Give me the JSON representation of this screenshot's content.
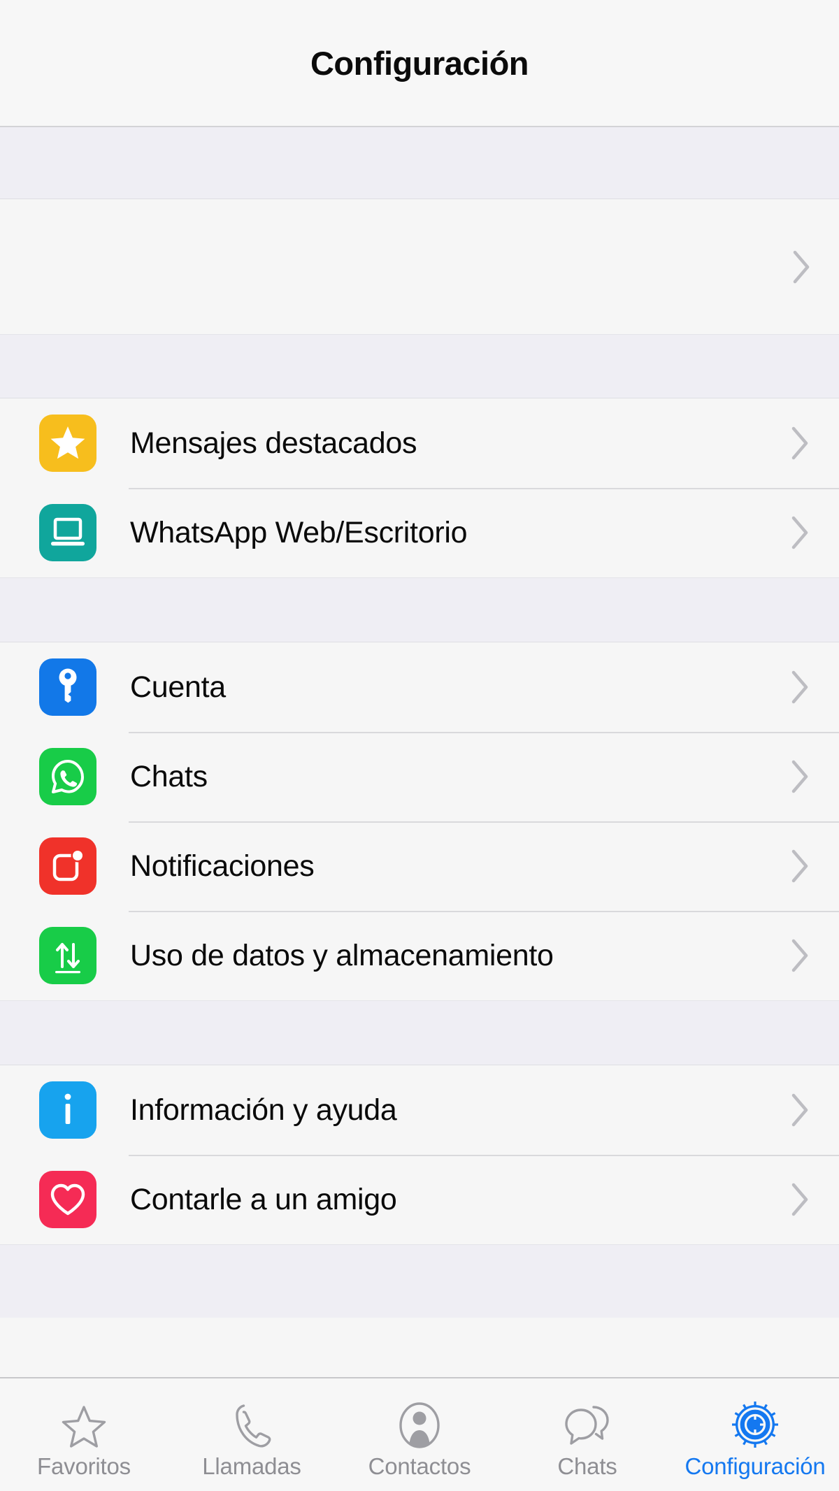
{
  "navbar": {
    "title": "Configuración"
  },
  "profile": {
    "name": "",
    "status": "",
    "chevron_icon": "chevron-right-icon"
  },
  "sections": [
    {
      "id": "starred-group",
      "items": [
        {
          "label": "Mensajes destacados",
          "icon": "star-icon",
          "color": "#F7BE1D",
          "chevron_icon": "chevron-right-icon"
        },
        {
          "label": "WhatsApp Web/Escritorio",
          "icon": "laptop-icon",
          "color": "#10A69C",
          "chevron_icon": "chevron-right-icon"
        }
      ]
    },
    {
      "id": "settings-group",
      "items": [
        {
          "label": "Cuenta",
          "icon": "key-icon",
          "color": "#1278E8",
          "chevron_icon": "chevron-right-icon"
        },
        {
          "label": "Chats",
          "icon": "whatsapp-icon",
          "color": "#18CC48",
          "chevron_icon": "chevron-right-icon"
        },
        {
          "label": "Notificaciones",
          "icon": "notification-badge-icon",
          "color": "#F0322A",
          "chevron_icon": "chevron-right-icon"
        },
        {
          "label": "Uso de datos y almacenamiento",
          "icon": "data-transfer-icon",
          "color": "#18CC48",
          "chevron_icon": "chevron-right-icon"
        }
      ]
    },
    {
      "id": "help-group",
      "items": [
        {
          "label": "Información y ayuda",
          "icon": "info-icon",
          "color": "#17A3EE",
          "chevron_icon": "chevron-right-icon"
        },
        {
          "label": "Contarle a un amigo",
          "icon": "heart-icon",
          "color": "#F52B55",
          "chevron_icon": "chevron-right-icon"
        }
      ]
    }
  ],
  "tabbar": {
    "active_color": "#1478F0",
    "inactive_color": "#8E8E93",
    "tabs": [
      {
        "label": "Favoritos",
        "icon": "star-outline-icon",
        "active": false
      },
      {
        "label": "Llamadas",
        "icon": "phone-icon",
        "active": false
      },
      {
        "label": "Contactos",
        "icon": "person-icon",
        "active": false
      },
      {
        "label": "Chats",
        "icon": "chat-bubbles-icon",
        "active": false
      },
      {
        "label": "Configuración",
        "icon": "gear-icon",
        "active": true
      }
    ]
  }
}
